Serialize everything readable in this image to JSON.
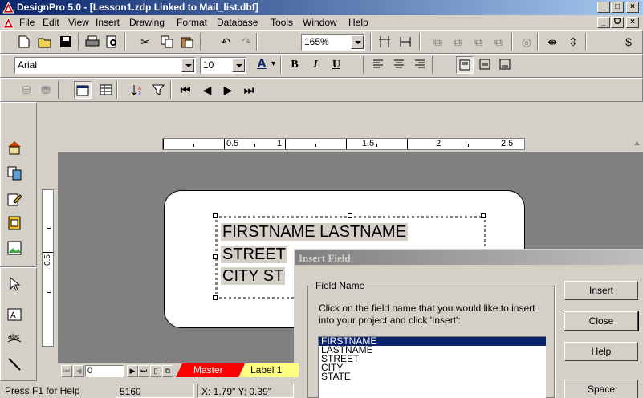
{
  "app": {
    "title": "DesignPro 5.0 - [Lesson1.zdp Linked to Mail_list.dbf]"
  },
  "menu": [
    "File",
    "Edit",
    "View",
    "Insert",
    "Drawing",
    "Format",
    "Database",
    "Tools",
    "Window",
    "Help"
  ],
  "toolbar": {
    "zoom_value": "165%",
    "font_value": "Arial",
    "size_value": "10",
    "bold": "B",
    "italic": "I",
    "underline": "U",
    "font_color_letter": "A"
  },
  "ruler": {
    "labels": [
      "0.5",
      "1",
      "1.5",
      "2",
      "2.5"
    ],
    "vertical_label": "0.5"
  },
  "label": {
    "line1": "FIRSTNAME LASTNAME",
    "line2": "STREET",
    "line3": "CITY ST"
  },
  "dialog": {
    "title": "Insert Field",
    "group_label": "Field Name",
    "instructions": "Click on the field name that you would like to insert into your project and click 'Insert':",
    "fields": [
      "FIRSTNAME",
      "LASTNAME",
      "STREET",
      "CITY",
      "STATE"
    ],
    "selected_field": "FIRSTNAME",
    "buttons": {
      "insert": "Insert",
      "close": "Close",
      "help": "Help",
      "space": "Space"
    }
  },
  "tabs": {
    "record_number": "0",
    "master": "Master",
    "label1": "Label 1"
  },
  "status": {
    "help": "Press F1 for Help",
    "code": "5160",
    "coords": "X: 1.79\"  Y: 0.39\""
  },
  "colors": {
    "titlebar": "#0a246a",
    "selection": "#0a246a",
    "master_tab": "#ff0000",
    "label_tab": "#ffff80",
    "workspace": "#808080"
  }
}
